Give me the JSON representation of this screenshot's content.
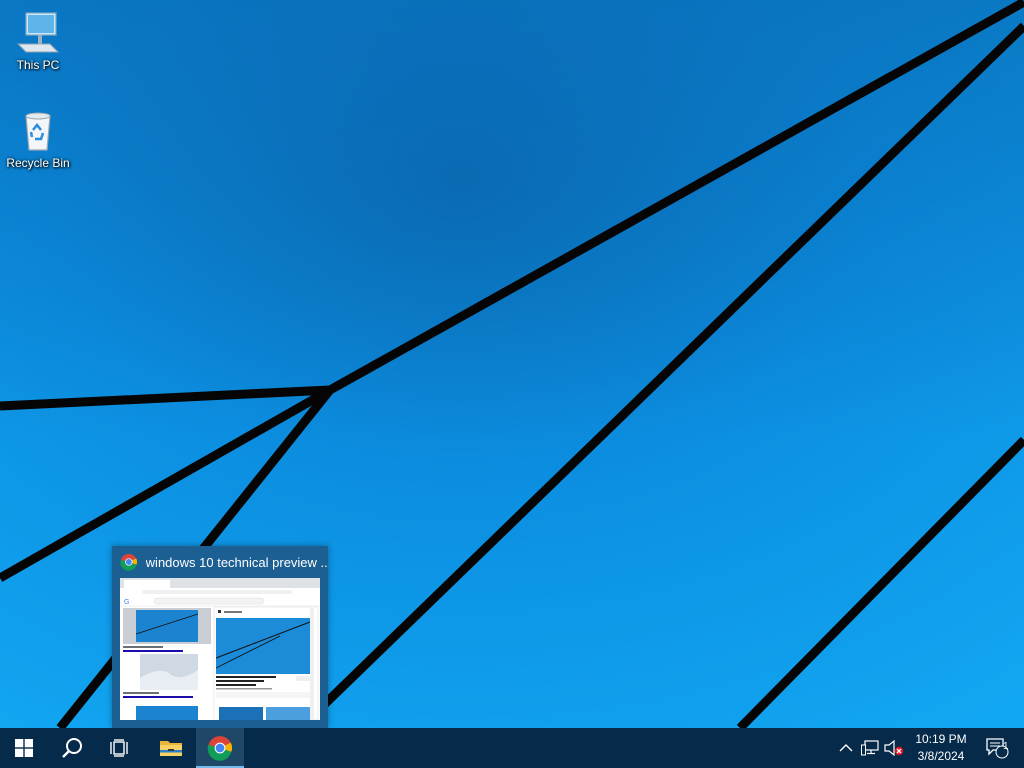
{
  "desktop": {
    "icons": [
      {
        "label": "This PC",
        "icon": "this-pc-icon"
      },
      {
        "label": "Recycle Bin",
        "icon": "recycle-bin-icon"
      }
    ]
  },
  "taskbar": {
    "buttons": [
      {
        "name": "start",
        "icon": "windows-logo-icon"
      },
      {
        "name": "search",
        "icon": "search-icon"
      },
      {
        "name": "task-view",
        "icon": "task-view-icon"
      },
      {
        "name": "file-explorer",
        "icon": "folder-icon"
      },
      {
        "name": "chrome",
        "icon": "chrome-icon",
        "active": true
      }
    ],
    "tray": {
      "time": "10:19 PM",
      "date": "3/8/2024",
      "notification_count": "1",
      "icons": [
        "chevron-up-icon",
        "network-icon",
        "volume-muted-icon",
        "action-center-icon"
      ]
    }
  },
  "preview": {
    "title": "windows 10 technical preview ...",
    "app_icon": "chrome-icon"
  },
  "colors": {
    "wallpaper": "#0a8fe0",
    "taskbar": "#062a4a",
    "preview_bg": "#1c5f93",
    "active_indicator": "#76b9ed"
  }
}
